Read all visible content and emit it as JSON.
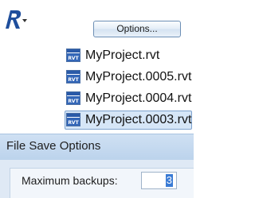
{
  "toolbar": {
    "app_icon": "revit-application-icon",
    "options_label": "Options..."
  },
  "recent_files": [
    {
      "name": "MyProject.rvt",
      "icon": "rvt-file-icon",
      "icon_text": "RVT",
      "selected": false
    },
    {
      "name": "MyProject.0005.rvt",
      "icon": "rvt-file-icon",
      "icon_text": "RVT",
      "selected": false
    },
    {
      "name": "MyProject.0004.rvt",
      "icon": "rvt-file-icon",
      "icon_text": "RVT",
      "selected": false
    },
    {
      "name": "MyProject.0003.rvt",
      "icon": "rvt-file-icon",
      "icon_text": "RVT",
      "selected": true
    }
  ],
  "dialog": {
    "title": "File Save Options",
    "max_backups_label": "Maximum backups:",
    "max_backups_value": "3"
  },
  "colors": {
    "app_icon_blue": "#1f4e9c",
    "selection_bg": "#d6e6f7",
    "dialog_title_bg": "#c6dbf0"
  }
}
